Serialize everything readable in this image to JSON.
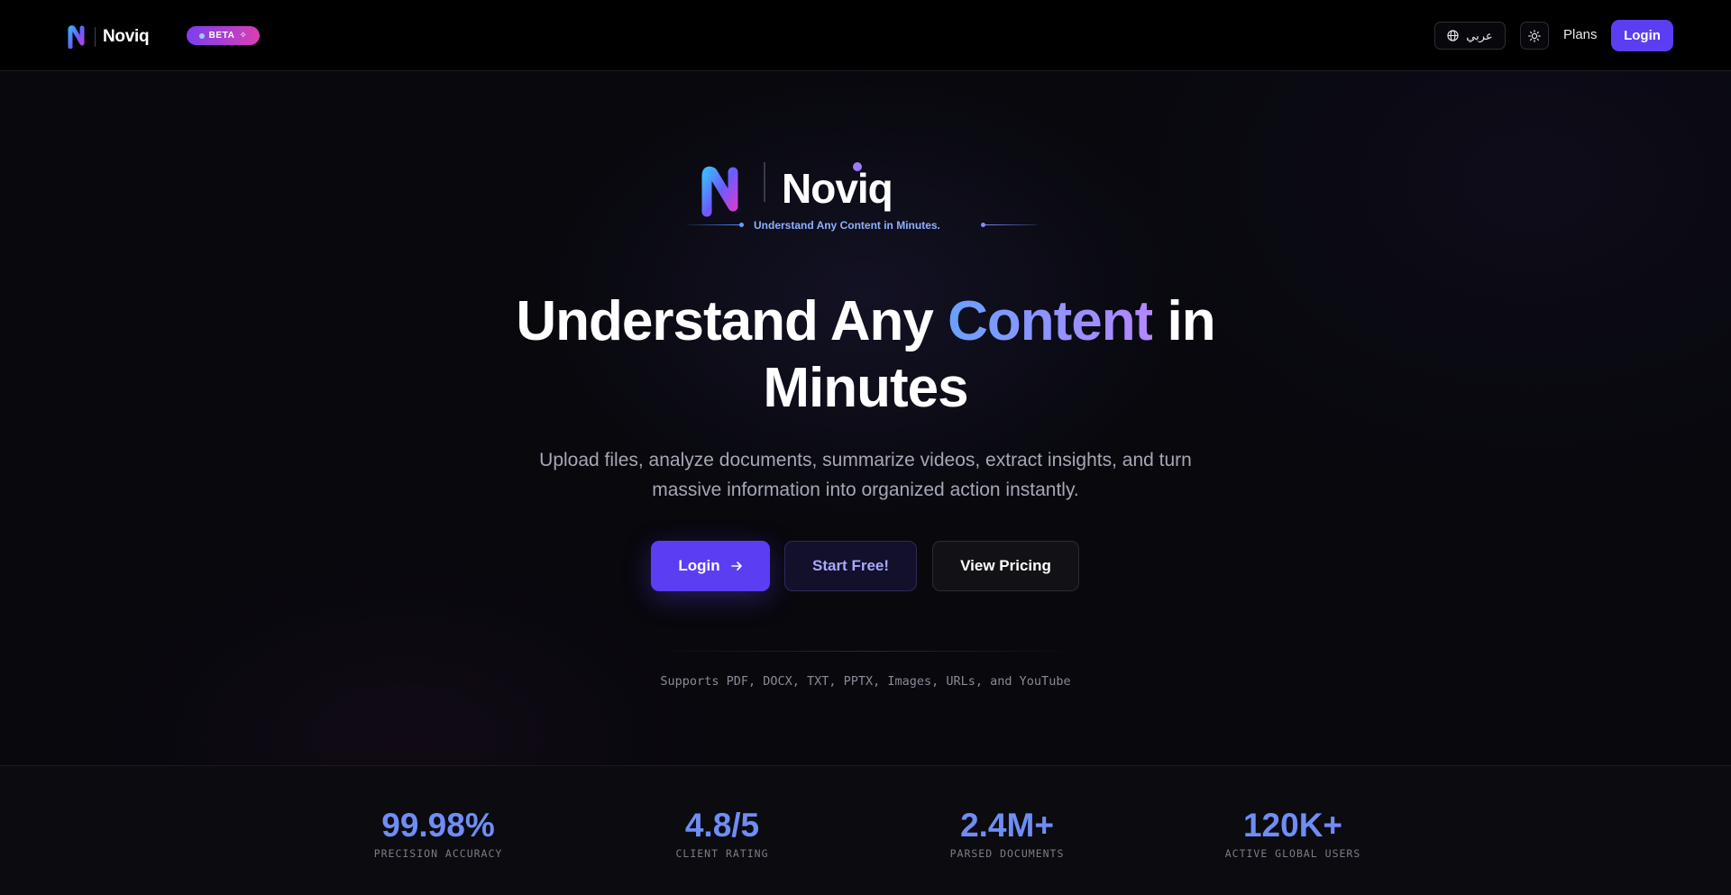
{
  "nav": {
    "brand_name": "Noviq",
    "beta_label": "BETA",
    "lang_label": "عربي",
    "plans_label": "Plans",
    "login_label": "Login"
  },
  "hero": {
    "logo_name": "Noviq",
    "tagline": "Understand Any Content in Minutes.",
    "headline_pre": "Understand Any ",
    "headline_accent": "Content",
    "headline_post": " in Minutes",
    "subtitle": "Upload files, analyze documents, summarize videos, extract insights, and turn massive information into organized action instantly.",
    "cta_login": "Login",
    "cta_start": "Start Free!",
    "cta_pricing": "View Pricing",
    "supports": "Supports PDF, DOCX, TXT, PPTX, Images, URLs, and YouTube"
  },
  "stats": [
    {
      "value": "99.98%",
      "label": "PRECISION ACCURACY"
    },
    {
      "value": "4.8/5",
      "label": "CLIENT RATING"
    },
    {
      "value": "2.4M+",
      "label": "PARSED DOCUMENTS"
    },
    {
      "value": "120K+",
      "label": "ACTIVE GLOBAL USERS"
    }
  ],
  "colors": {
    "accent": "#5b3ef2",
    "stat_value": "#6f8df5",
    "headline_gradient_start": "#6aa0ff",
    "headline_gradient_end": "#b487ff"
  },
  "icons": [
    "logo-mark-icon",
    "sparkle-icon",
    "globe-icon",
    "sun-icon",
    "arrow-right-icon"
  ]
}
